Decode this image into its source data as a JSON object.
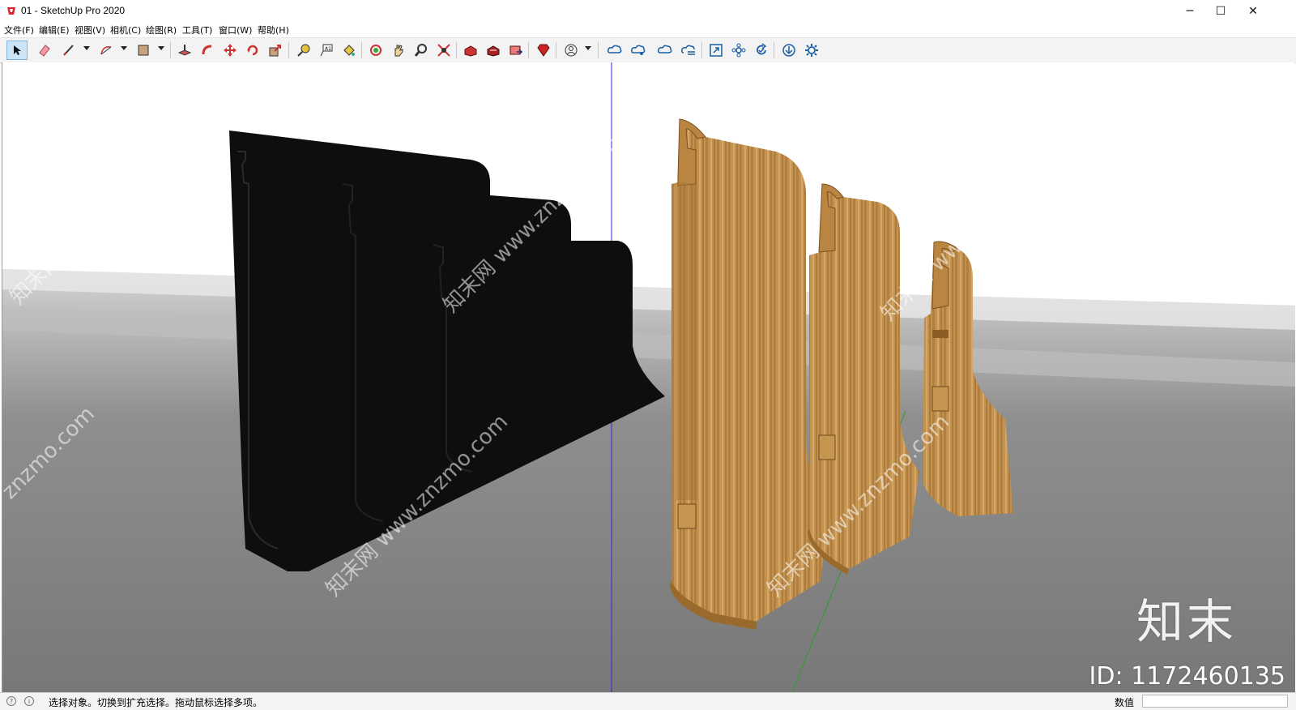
{
  "window": {
    "title": "01 - SketchUp Pro 2020",
    "minimize": "─",
    "maximize": "☐",
    "close": "✕"
  },
  "menu": [
    {
      "label": "文件(F)"
    },
    {
      "label": "编辑(E)"
    },
    {
      "label": "视图(V)"
    },
    {
      "label": "相机(C)"
    },
    {
      "label": "绘图(R)"
    },
    {
      "label": "工具(T)"
    },
    {
      "label": "窗口(W)"
    },
    {
      "label": "帮助(H)"
    }
  ],
  "toolbar": {
    "tools": [
      "select-icon",
      "eraser-icon",
      "line-icon",
      "arc-icon",
      "rectangle-icon",
      "push-pull-icon",
      "follow-me-icon",
      "move-icon",
      "rotate-icon",
      "scale-icon",
      "tape-measure-icon",
      "text-icon",
      "paint-bucket-icon",
      "orbit-icon",
      "pan-icon",
      "zoom-icon",
      "zoom-extents-icon",
      "warehouse-icon",
      "extension-warehouse-icon",
      "send-to-layout-icon",
      "extension-manager-icon",
      "account-icon",
      "trimble-connect-icon",
      "trimble-share-icon",
      "cloud-sync-icon",
      "cloud-list-icon",
      "fit-view-icon",
      "components-icon",
      "refresh-icon",
      "download-icon",
      "settings-icon"
    ]
  },
  "colors": {
    "ground": "#7f7f7f",
    "sky": "#ffffff",
    "wood_light": "#c89a55",
    "wood_dark": "#8a5a22",
    "black_profile": "#0d0d0d",
    "axis_blue": "#2a2ae0",
    "axis_green": "#2aa02a"
  },
  "viewport": {
    "watermark_text": "znzmo.com",
    "watermark_cn": "知末网 www.znzmo.com",
    "logo_text": "知末",
    "id_text": "ID: 1172460135"
  },
  "status": {
    "message": "选择对象。切换到扩充选择。拖动鼠标选择多项。",
    "vcb_label": "数值",
    "vcb_value": "",
    "icon_geo": "?",
    "icon_info": "i"
  }
}
